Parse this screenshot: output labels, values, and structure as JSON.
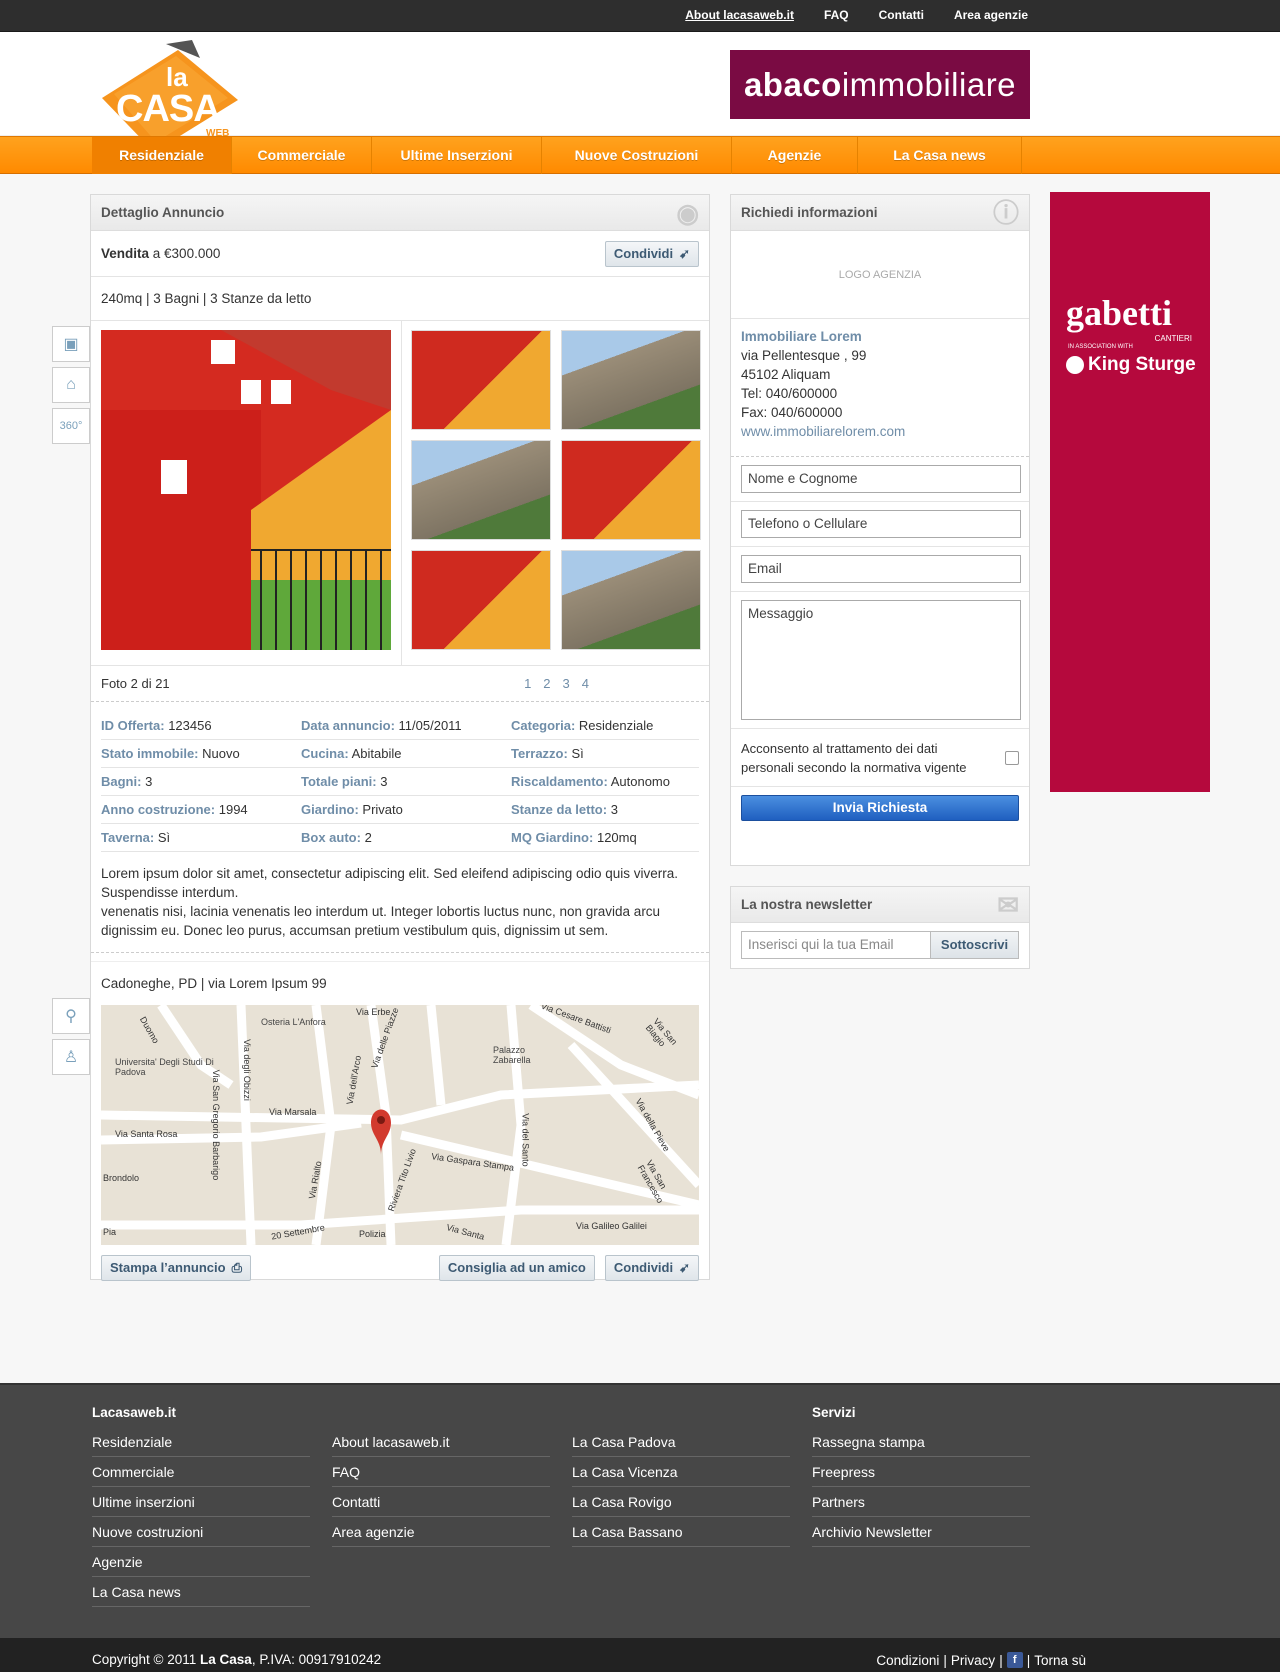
{
  "top_links": [
    "About lacasaweb.it",
    "FAQ",
    "Contatti",
    "Area agenzie"
  ],
  "logo": {
    "word1": "la",
    "word2": "CASA",
    "word3": "WEB"
  },
  "top_ad": {
    "strong": "abaco",
    "rest": "immobiliare"
  },
  "nav": [
    "Residenziale",
    "Commerciale",
    "Ultime Inserzioni",
    "Nuove Costruzioni",
    "Agenzie",
    "La Casa news"
  ],
  "listing": {
    "panel_title": "Dettaglio Annuncio",
    "sale_label": "Vendita",
    "sale_text": "a €300.000",
    "share_label": "Condividi",
    "features": "240mq | 3 Bagni | 3 Stanze da letto",
    "photo_counter": "Foto 2 di 21",
    "pages": [
      "1",
      "2",
      "3",
      "4"
    ],
    "details": [
      [
        {
          "k": "ID Offerta:",
          "v": "123456"
        },
        {
          "k": "Data annuncio:",
          "v": "11/05/2011"
        },
        {
          "k": "Categoria:",
          "v": "Residenziale"
        }
      ],
      [
        {
          "k": "Stato immobile:",
          "v": "Nuovo"
        },
        {
          "k": "Cucina:",
          "v": "Abitabile"
        },
        {
          "k": "Terrazzo:",
          "v": "Sì"
        }
      ],
      [
        {
          "k": "Bagni:",
          "v": "3"
        },
        {
          "k": "Totale piani:",
          "v": "3"
        },
        {
          "k": "Riscaldamento:",
          "v": "Autonomo"
        }
      ],
      [
        {
          "k": "Anno costruzione:",
          "v": "1994"
        },
        {
          "k": "Giardino:",
          "v": "Privato"
        },
        {
          "k": "Stanze da letto:",
          "v": "3"
        }
      ],
      [
        {
          "k": "Taverna:",
          "v": "Sì"
        },
        {
          "k": "Box auto:",
          "v": "2"
        },
        {
          "k": "MQ Giardino:",
          "v": "120mq"
        }
      ]
    ],
    "description_1": "Lorem ipsum dolor sit amet, consectetur adipiscing elit. Sed eleifend adipiscing odio quis viverra. Suspendisse interdum.",
    "description_2": "venenatis nisi, lacinia venenatis leo interdum ut. Integer lobortis luctus nunc, non gravida arcu dignissim eu. Donec leo purus, accumsan pretium vestibulum quis, dignissim ut sem.",
    "address": "Cadoneghe, PD | via Lorem Ipsum 99",
    "print_label": "Stampa l’annuncio",
    "recommend_label": "Consiglia ad un amico"
  },
  "map_labels": [
    "Osteria L'Anfora",
    "Universita' Degli Studi Di Padova",
    "Via Marsala",
    "Via Santa Rosa",
    "Via Gaspara Stampa",
    "Via Galileo Galilei",
    "Palazzo Zabarella",
    "Via Cesare Battisti",
    "Via San Biagio",
    "Via del Santo",
    "Via degli Obizzi",
    "Via San Gregorio Barbarigo",
    "Via Rialto",
    "Via dell'Arco",
    "Via delle Piazze",
    "Via Erbe",
    "Riviera Tito Livio",
    "Polizia",
    "Via della Pieve",
    "Via San Francesco",
    "Via Santa",
    "20 Settembre",
    "Brondolo",
    "Duomo",
    "Pia"
  ],
  "contact": {
    "panel_title": "Richiedi informazioni",
    "logo_placeholder": "LOGO AGENZIA",
    "agency_name": "Immobiliare Lorem",
    "street": "via Pellentesque , 99",
    "city": "45102 Aliquam",
    "tel": "Tel: 040/600000",
    "fax": "Fax: 040/600000",
    "web": "www.immobiliarelorem.com",
    "name_ph": "Nome e Cognome",
    "phone_ph": "Telefono o Cellulare",
    "email_ph": "Email",
    "message_ph": "Messaggio",
    "consent": "Acconsento al trattamento dei dati personali secondo la normativa vigente",
    "submit": "Invia Richiesta"
  },
  "newsletter": {
    "title": "La nostra newsletter",
    "placeholder": "Inserisci qui la tua Email",
    "button": "Sottoscrivi"
  },
  "side_ad": {
    "brand": "gabetti",
    "sub": "CANTIERI",
    "assoc": "IN ASSOCIATION WITH",
    "partner": "King Sturge"
  },
  "footer": {
    "col1_title": "Lacasaweb.it",
    "col1": [
      "Residenziale",
      "Commerciale",
      "Ultime inserzioni",
      "Nuove costruzioni",
      "Agenzie",
      "La Casa news"
    ],
    "col2": [
      "About lacasaweb.it",
      "FAQ",
      "Contatti",
      "Area agenzie"
    ],
    "col3": [
      "La Casa Padova",
      "La Casa  Vicenza",
      "La Casa Rovigo",
      "La Casa Bassano"
    ],
    "col4_title": "Servizi",
    "col4": [
      "Rassegna stampa",
      "Freepress",
      "Partners",
      "Archivio Newsletter"
    ],
    "copyright_pre": "Copyright © 2011",
    "copyright_brand": "La Casa",
    "copyright_post": ", P.IVA: 00917910242",
    "links": [
      "Condizioni",
      "Privacy",
      "Torna sù"
    ]
  },
  "colors": {
    "accent": "#ff9a10",
    "link": "#6f8da8",
    "ad": "#b5093d"
  },
  "icons": [
    "photo-icon",
    "video-icon",
    "360-icon",
    "eye-icon",
    "info-icon",
    "mail-icon",
    "map-icon",
    "streetview-icon",
    "share-icon",
    "print-icon",
    "facebook-icon"
  ]
}
